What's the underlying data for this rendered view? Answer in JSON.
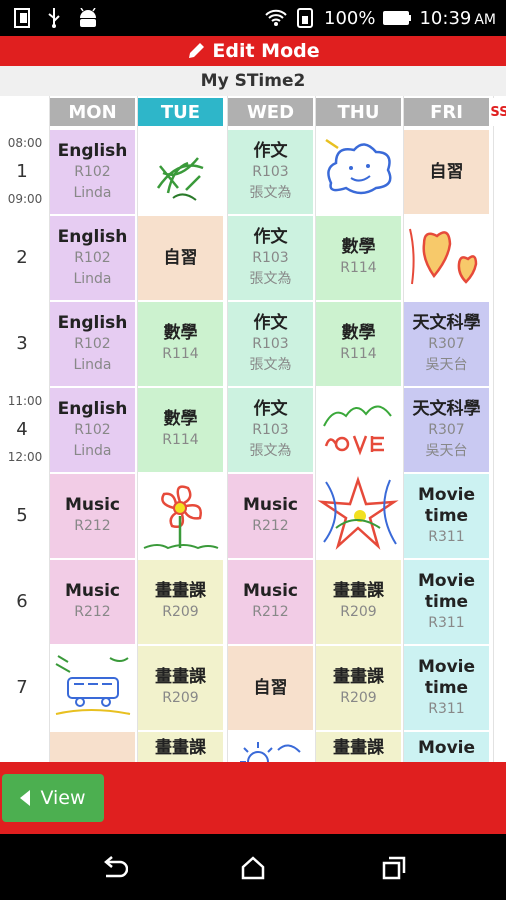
{
  "status": {
    "battery": "100%",
    "time": "10:39",
    "ampm": "AM"
  },
  "edit_bar": {
    "label": "Edit Mode"
  },
  "timetable": {
    "title": "My STime2"
  },
  "days": [
    "MON",
    "TUE",
    "WED",
    "THU",
    "FRI"
  ],
  "days_peek": "SS",
  "rows": [
    {
      "num": "1",
      "start": "08:00",
      "end": "09:00"
    },
    {
      "num": "2"
    },
    {
      "num": "3"
    },
    {
      "num": "4",
      "start": "11:00",
      "end": "12:00"
    },
    {
      "num": "5"
    },
    {
      "num": "6"
    },
    {
      "num": "7"
    },
    {
      "num": ""
    }
  ],
  "cells": [
    [
      {
        "subject": "English",
        "room": "R102",
        "teacher": "Linda",
        "kind": "english"
      },
      {
        "subject": "",
        "kind": "img",
        "img": "drawing-plant"
      },
      {
        "subject": "作文",
        "room": "R103",
        "teacher": "張文為",
        "kind": "essay"
      },
      {
        "subject": "",
        "kind": "img",
        "img": "drawing-cloud"
      },
      {
        "subject": "自習",
        "kind": "self"
      }
    ],
    [
      {
        "subject": "English",
        "room": "R102",
        "teacher": "Linda",
        "kind": "english"
      },
      {
        "subject": "自習",
        "kind": "self"
      },
      {
        "subject": "作文",
        "room": "R103",
        "teacher": "張文為",
        "kind": "essay"
      },
      {
        "subject": "數學",
        "room": "R114",
        "kind": "math"
      },
      {
        "subject": "",
        "kind": "img",
        "img": "drawing-hearts"
      }
    ],
    [
      {
        "subject": "English",
        "room": "R102",
        "teacher": "Linda",
        "kind": "english"
      },
      {
        "subject": "數學",
        "room": "R114",
        "kind": "math"
      },
      {
        "subject": "作文",
        "room": "R103",
        "teacher": "張文為",
        "kind": "essay"
      },
      {
        "subject": "數學",
        "room": "R114",
        "kind": "math"
      },
      {
        "subject": "天文科學",
        "room": "R307",
        "teacher": "吳天台",
        "kind": "astro"
      }
    ],
    [
      {
        "subject": "English",
        "room": "R102",
        "teacher": "Linda",
        "kind": "english"
      },
      {
        "subject": "數學",
        "room": "R114",
        "kind": "math"
      },
      {
        "subject": "作文",
        "room": "R103",
        "teacher": "張文為",
        "kind": "essay"
      },
      {
        "subject": "",
        "kind": "img",
        "img": "drawing-love"
      },
      {
        "subject": "天文科學",
        "room": "R307",
        "teacher": "吳天台",
        "kind": "astro"
      }
    ],
    [
      {
        "subject": "Music",
        "room": "R212",
        "kind": "music"
      },
      {
        "subject": "",
        "kind": "img",
        "img": "drawing-flower"
      },
      {
        "subject": "Music",
        "room": "R212",
        "kind": "music"
      },
      {
        "subject": "",
        "kind": "img",
        "img": "drawing-star"
      },
      {
        "subject": "Movie time",
        "room": "R311",
        "kind": "movie"
      }
    ],
    [
      {
        "subject": "Music",
        "room": "R212",
        "kind": "music"
      },
      {
        "subject": "畫畫課",
        "room": "R209",
        "kind": "art"
      },
      {
        "subject": "Music",
        "room": "R212",
        "kind": "music"
      },
      {
        "subject": "畫畫課",
        "room": "R209",
        "kind": "art"
      },
      {
        "subject": "Movie time",
        "room": "R311",
        "kind": "movie"
      }
    ],
    [
      {
        "subject": "",
        "kind": "img",
        "img": "drawing-bus"
      },
      {
        "subject": "畫畫課",
        "room": "R209",
        "kind": "art"
      },
      {
        "subject": "自習",
        "kind": "self"
      },
      {
        "subject": "畫畫課",
        "room": "R209",
        "kind": "art"
      },
      {
        "subject": "Movie time",
        "room": "R311",
        "kind": "movie"
      }
    ],
    [
      {
        "subject": "",
        "kind": "self"
      },
      {
        "subject": "畫畫課",
        "kind": "art"
      },
      {
        "subject": "",
        "kind": "img",
        "img": "drawing-sun"
      },
      {
        "subject": "畫畫課",
        "kind": "art"
      },
      {
        "subject": "Movie",
        "kind": "movie"
      }
    ]
  ],
  "bottom": {
    "view_label": "View"
  },
  "colors": {
    "accent_red": "#e01f1f",
    "selected_day": "#2eb6c9",
    "view_button": "#4caf50"
  }
}
